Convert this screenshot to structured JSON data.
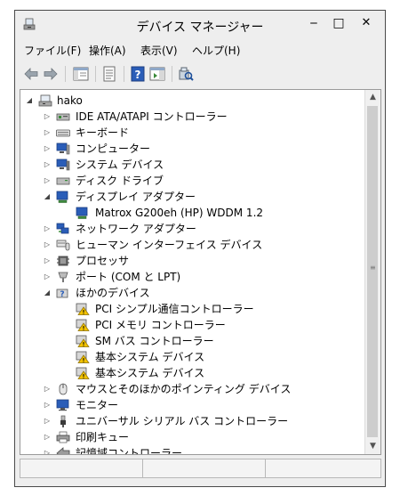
{
  "window": {
    "title": "デバイス マネージャー"
  },
  "titlebar_buttons": {
    "minimize": "‒",
    "maximize": "□",
    "close": "✕"
  },
  "menu": [
    {
      "label": "ファイル(F)"
    },
    {
      "label": "操作(A)"
    },
    {
      "label": "表示(V)"
    },
    {
      "label": "ヘルプ(H)"
    }
  ],
  "tree": {
    "root": "hako",
    "items": [
      {
        "label": "IDE ATA/ATAPI コントローラー",
        "icon": "ide-controller-icon",
        "expander": "collapsed"
      },
      {
        "label": "キーボード",
        "icon": "keyboard-icon",
        "expander": "collapsed"
      },
      {
        "label": "コンピューター",
        "icon": "computer-icon",
        "expander": "collapsed"
      },
      {
        "label": "システム デバイス",
        "icon": "system-device-icon",
        "expander": "collapsed"
      },
      {
        "label": "ディスク ドライブ",
        "icon": "disk-drive-icon",
        "expander": "collapsed"
      },
      {
        "label": "ディスプレイ アダプター",
        "icon": "display-adapter-icon",
        "expander": "expanded"
      },
      {
        "label": "Matrox G200eh (HP) WDDM 1.2",
        "icon": "display-adapter-icon",
        "expander": "none",
        "child": true
      },
      {
        "label": "ネットワーク アダプター",
        "icon": "network-adapter-icon",
        "expander": "collapsed"
      },
      {
        "label": "ヒューマン インターフェイス デバイス",
        "icon": "hid-icon",
        "expander": "collapsed"
      },
      {
        "label": "プロセッサ",
        "icon": "processor-icon",
        "expander": "collapsed"
      },
      {
        "label": "ポート (COM と LPT)",
        "icon": "port-icon",
        "expander": "collapsed"
      },
      {
        "label": "ほかのデバイス",
        "icon": "other-device-icon",
        "expander": "expanded"
      },
      {
        "label": "PCI シンプル通信コントローラー",
        "icon": "warning-device-icon",
        "expander": "none",
        "child": true
      },
      {
        "label": "PCI メモリ コントローラー",
        "icon": "warning-device-icon",
        "expander": "none",
        "child": true
      },
      {
        "label": "SM バス コントローラー",
        "icon": "warning-device-icon",
        "expander": "none",
        "child": true
      },
      {
        "label": "基本システム デバイス",
        "icon": "warning-device-icon",
        "expander": "none",
        "child": true
      },
      {
        "label": "基本システム デバイス",
        "icon": "warning-device-icon",
        "expander": "none",
        "child": true
      },
      {
        "label": "マウスとそのほかのポインティング デバイス",
        "icon": "mouse-icon",
        "expander": "collapsed"
      },
      {
        "label": "モニター",
        "icon": "monitor-icon",
        "expander": "collapsed"
      },
      {
        "label": "ユニバーサル シリアル バス コントローラー",
        "icon": "usb-icon",
        "expander": "collapsed"
      },
      {
        "label": "印刷キュー",
        "icon": "printer-icon",
        "expander": "collapsed"
      },
      {
        "label": "記憶域コントローラー",
        "icon": "storage-controller-icon",
        "expander": "collapsed"
      }
    ]
  },
  "colors": {
    "window_bg": "#eeeeee",
    "warning": "#f2c200",
    "accent_blue": "#2a5db8"
  }
}
